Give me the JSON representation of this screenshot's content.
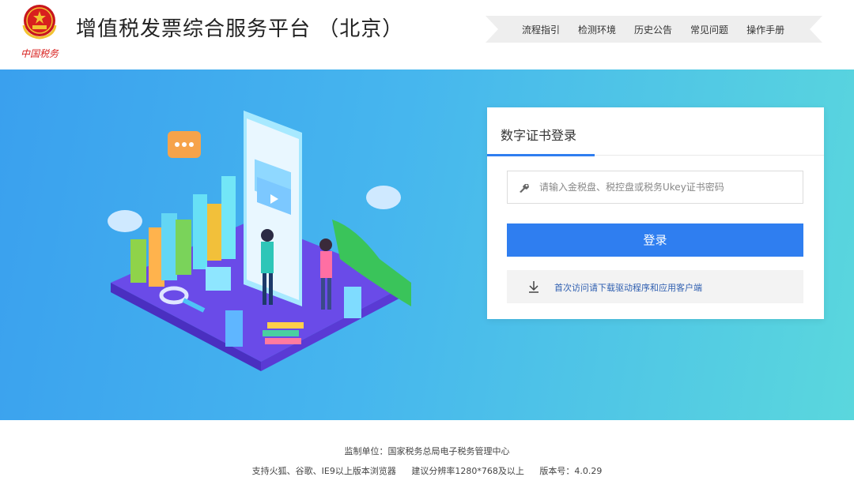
{
  "header": {
    "logo_text": "中国税务",
    "title": "增值税发票综合服务平台 （北京）",
    "nav": [
      "流程指引",
      "检测环境",
      "历史公告",
      "常见问题",
      "操作手册"
    ]
  },
  "login": {
    "tab_title": "数字证书登录",
    "password_placeholder": "请输入金税盘、税控盘或税务Ukey证书密码",
    "password_value": "",
    "login_button": "登录",
    "download_text": "首次访问请下载驱动程序和应用客户端"
  },
  "footer": {
    "line1": "监制单位：国家税务总局电子税务管理中心",
    "browsers": "支持火狐、谷歌、IE9以上版本浏览器",
    "resolution": "建议分辨率1280*768及以上",
    "version": "版本号：4.0.29"
  },
  "colors": {
    "accent": "#2f7ef0",
    "banner_start": "#3aa0ee",
    "banner_end": "#5ad7dd",
    "logo_red": "#d8201e"
  },
  "icons": {
    "logo": "tax-emblem-icon",
    "password": "key-icon",
    "download": "download-arrow-icon"
  }
}
